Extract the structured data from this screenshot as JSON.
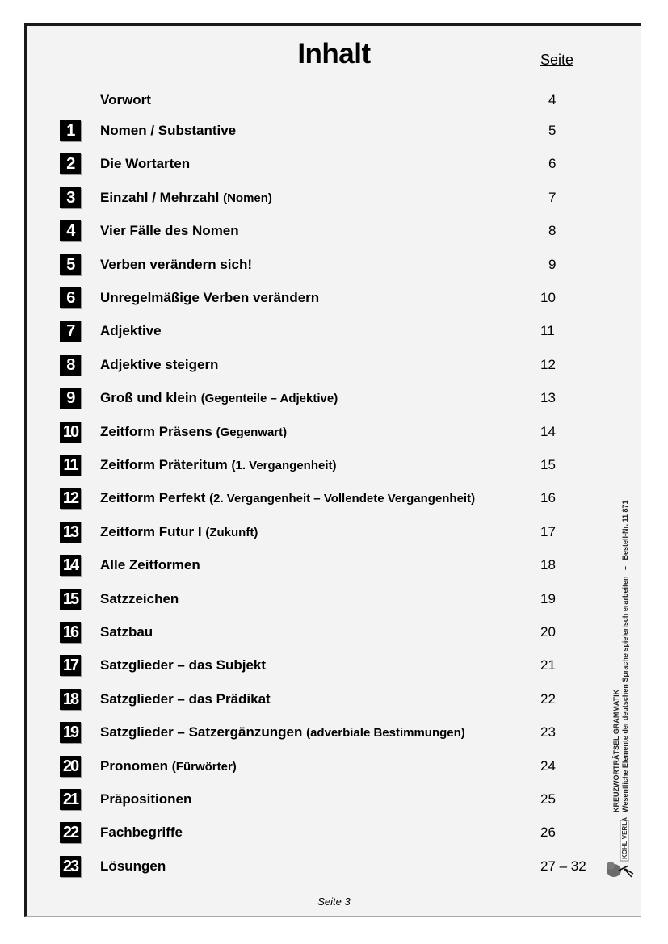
{
  "document": {
    "title": "Inhalt",
    "page_column_header": "Seite",
    "footer_page_label": "Seite 3"
  },
  "toc": {
    "preface": {
      "label": "Vorwort",
      "page": "4"
    },
    "entries": [
      {
        "num": "1",
        "title": "Nomen / Substantive",
        "subtitle": "",
        "page": "5"
      },
      {
        "num": "2",
        "title": "Die Wortarten",
        "subtitle": "",
        "page": "6"
      },
      {
        "num": "3",
        "title": "Einzahl / Mehrzahl",
        "subtitle": "(Nomen)",
        "page": "7"
      },
      {
        "num": "4",
        "title": "Vier Fälle des Nomen",
        "subtitle": "",
        "page": "8"
      },
      {
        "num": "5",
        "title": "Verben verändern sich!",
        "subtitle": "",
        "page": "9"
      },
      {
        "num": "6",
        "title": "Unregelmäßige Verben verändern",
        "subtitle": "",
        "page": "10"
      },
      {
        "num": "7",
        "title": "Adjektive",
        "subtitle": "",
        "page": "11"
      },
      {
        "num": "8",
        "title": "Adjektive steigern",
        "subtitle": "",
        "page": "12"
      },
      {
        "num": "9",
        "title": "Groß und klein",
        "subtitle": "(Gegenteile – Adjektive)",
        "page": "13"
      },
      {
        "num": "10",
        "title": "Zeitform Präsens",
        "subtitle": "(Gegenwart)",
        "page": "14"
      },
      {
        "num": "11",
        "title": "Zeitform Präteritum",
        "subtitle": "(1. Vergangenheit)",
        "page": "15"
      },
      {
        "num": "12",
        "title": "Zeitform Perfekt",
        "subtitle": "(2. Vergangenheit – Vollendete Vergangenheit)",
        "page": "16"
      },
      {
        "num": "13",
        "title": "Zeitform Futur I",
        "subtitle": "(Zukunft)",
        "page": "17"
      },
      {
        "num": "14",
        "title": "Alle Zeitformen",
        "subtitle": "",
        "page": "18"
      },
      {
        "num": "15",
        "title": "Satzzeichen",
        "subtitle": "",
        "page": "19"
      },
      {
        "num": "16",
        "title": "Satzbau",
        "subtitle": "",
        "page": "20"
      },
      {
        "num": "17",
        "title": "Satzglieder – das Subjekt",
        "subtitle": "",
        "page": "21"
      },
      {
        "num": "18",
        "title": "Satzglieder – das Prädikat",
        "subtitle": "",
        "page": "22"
      },
      {
        "num": "19",
        "title": "Satzglieder – Satzergänzungen",
        "subtitle": "(adverbiale Bestimmungen)",
        "page": "23"
      },
      {
        "num": "20",
        "title": "Pronomen",
        "subtitle": "(Fürwörter)",
        "page": "24"
      },
      {
        "num": "21",
        "title": "Präpositionen",
        "subtitle": "",
        "page": "25"
      },
      {
        "num": "22",
        "title": "Fachbegriffe",
        "subtitle": "",
        "page": "26"
      },
      {
        "num": "23",
        "title": "Lösungen",
        "subtitle": "",
        "page": "27 – 32"
      }
    ]
  },
  "sidebar": {
    "series_title": "KREUZWORTRÄTSEL GRAMMATIK",
    "subtitle": "Wesentliche Elemente der deutschen Sprache spielerisch erarbeiten",
    "separator": "–",
    "order_number": "Bestell-Nr. 11 871",
    "publisher_logo_text": "KOHL VERLAG",
    "publisher_logo_icon": "tree-icon"
  },
  "colors": {
    "page_background": "#f3f3f3",
    "badge_background": "#000000",
    "badge_text": "#ffffff",
    "text": "#000000"
  }
}
